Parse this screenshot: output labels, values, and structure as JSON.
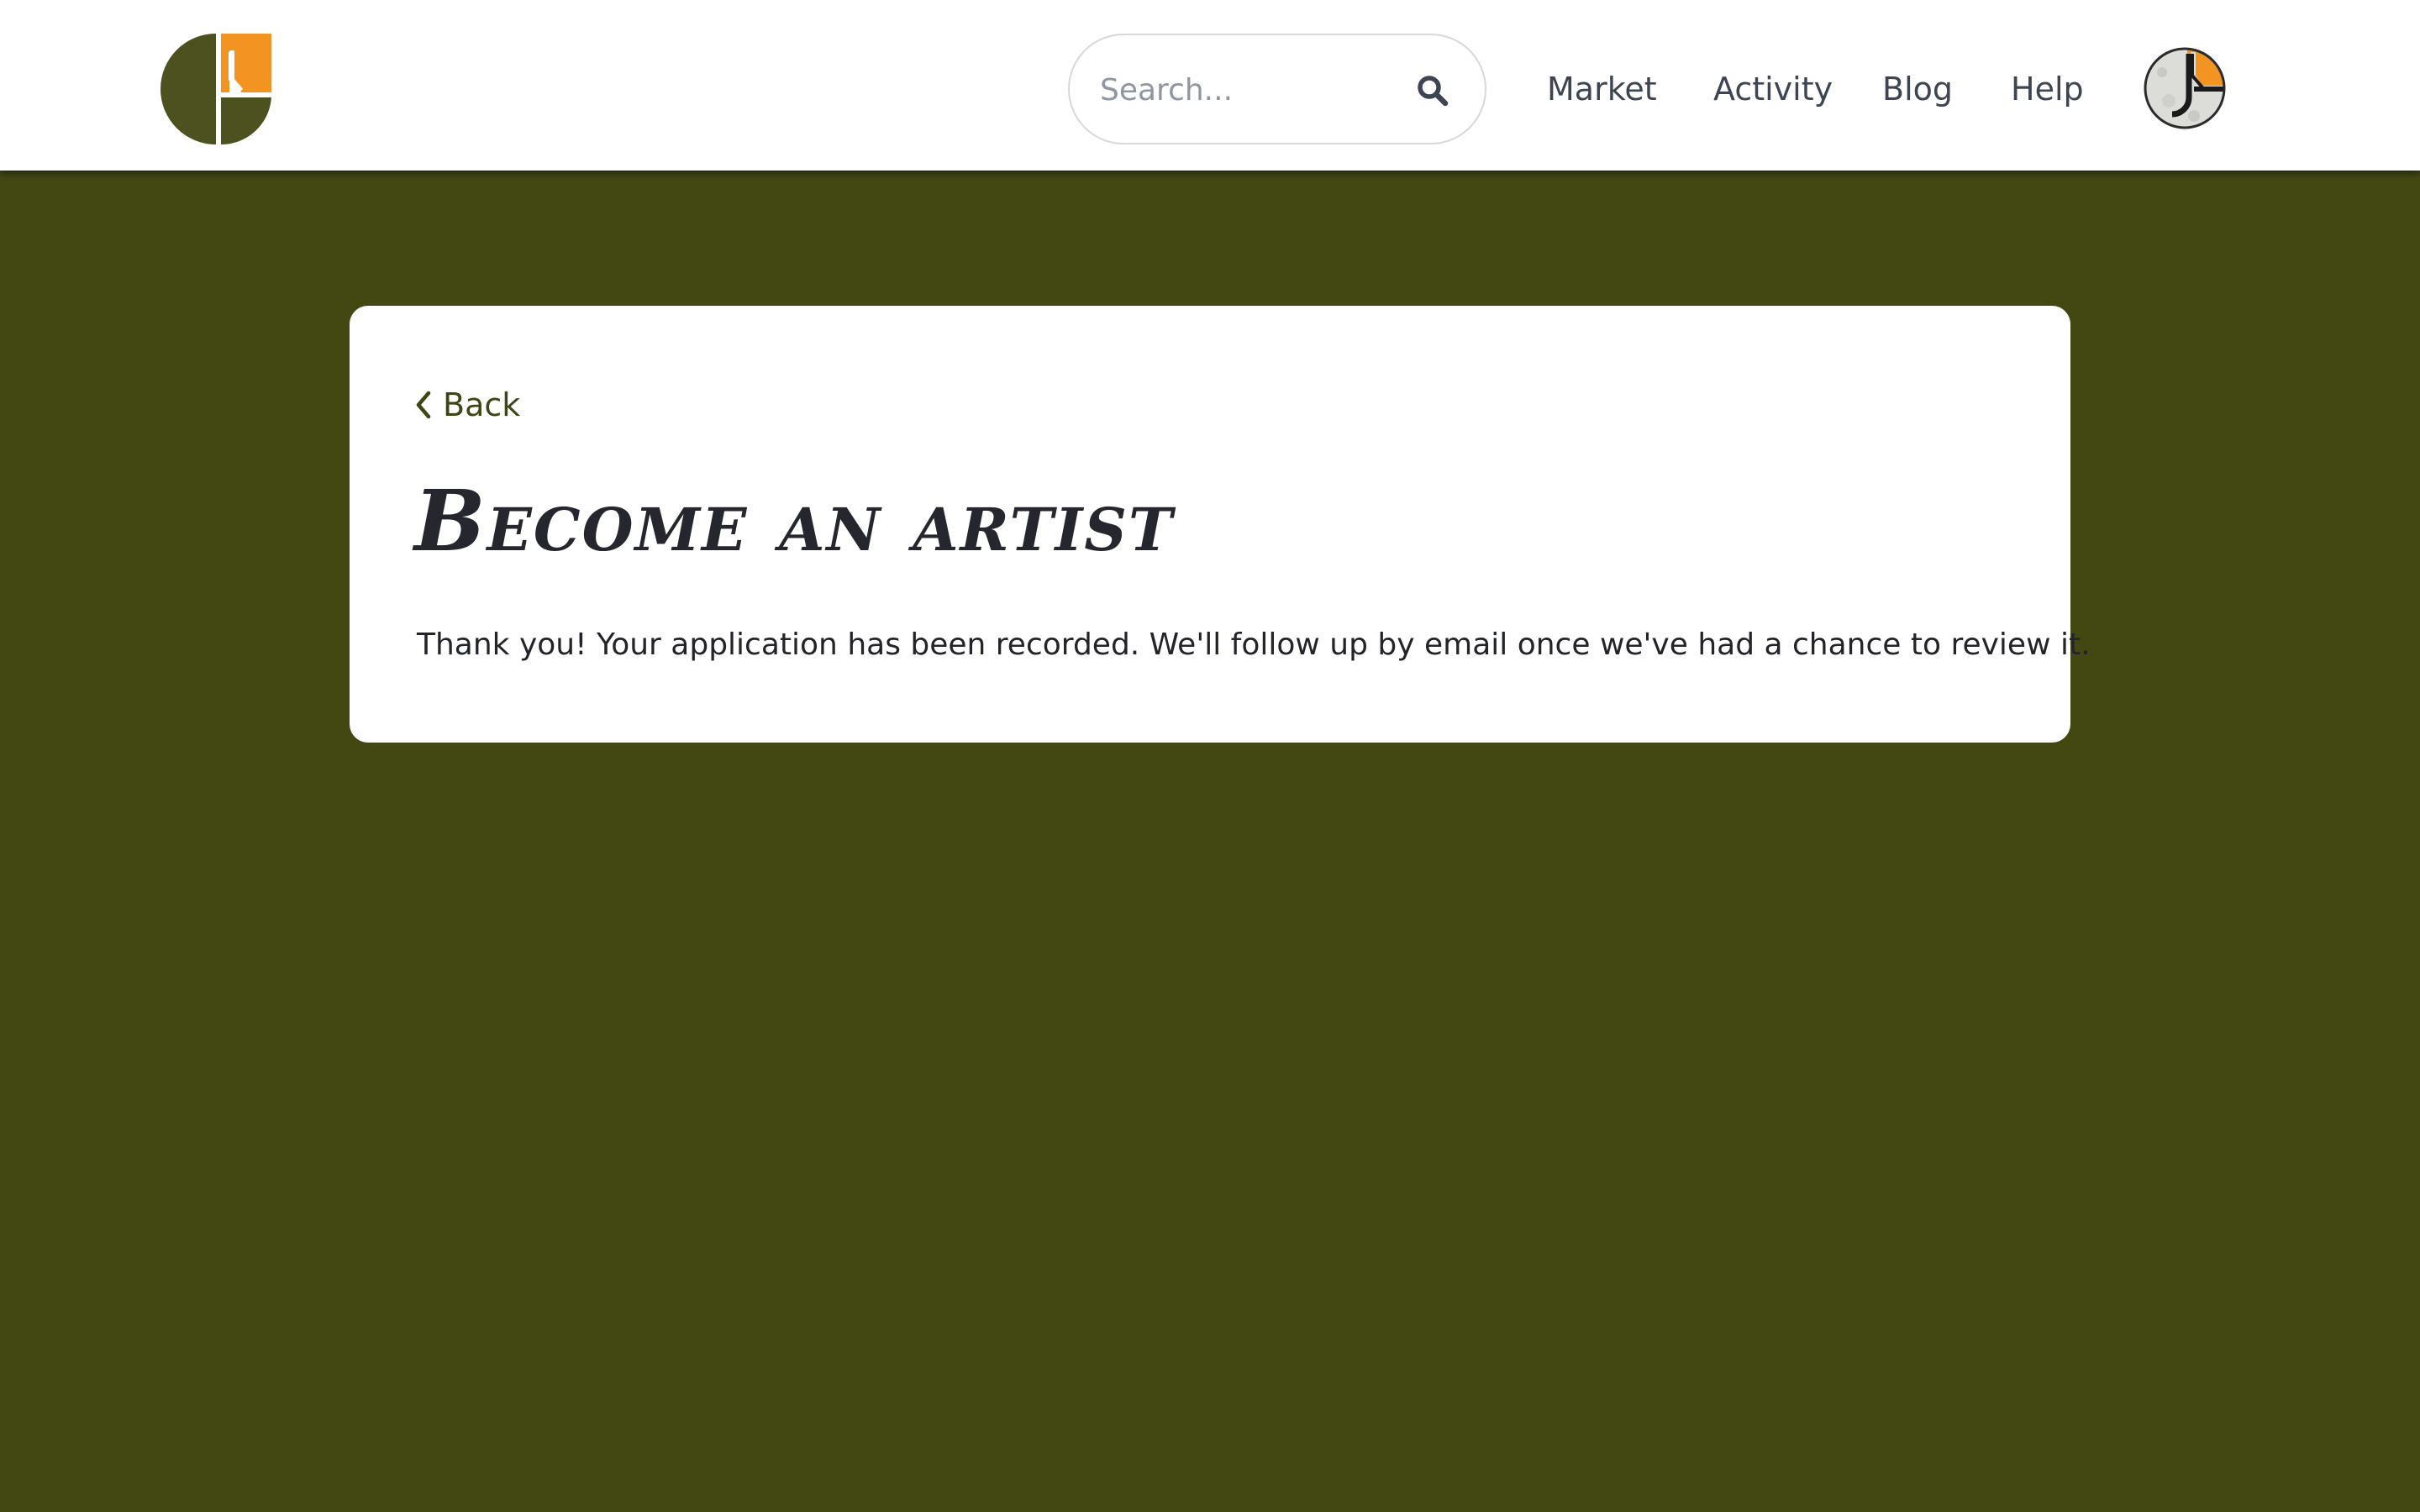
{
  "header": {
    "logo_icon": "brand-logo-icon",
    "search": {
      "placeholder": "Search...",
      "value": "",
      "icon": "search-icon"
    },
    "nav": [
      {
        "label": "Market"
      },
      {
        "label": "Activity"
      },
      {
        "label": "Blog"
      },
      {
        "label": "Help"
      }
    ],
    "avatar_icon": "user-avatar"
  },
  "card": {
    "back_label": "Back",
    "back_icon": "chevron-left-icon",
    "title": "Become an artist",
    "message": "Thank you! Your application has been recorded. We'll follow up by email once we've had a chance to review it."
  },
  "colors": {
    "page_background": "#434813",
    "brand_olive": "#4d5120",
    "brand_orange": "#f39321",
    "text_dark": "#25262e",
    "nav_text": "#3d4553"
  }
}
